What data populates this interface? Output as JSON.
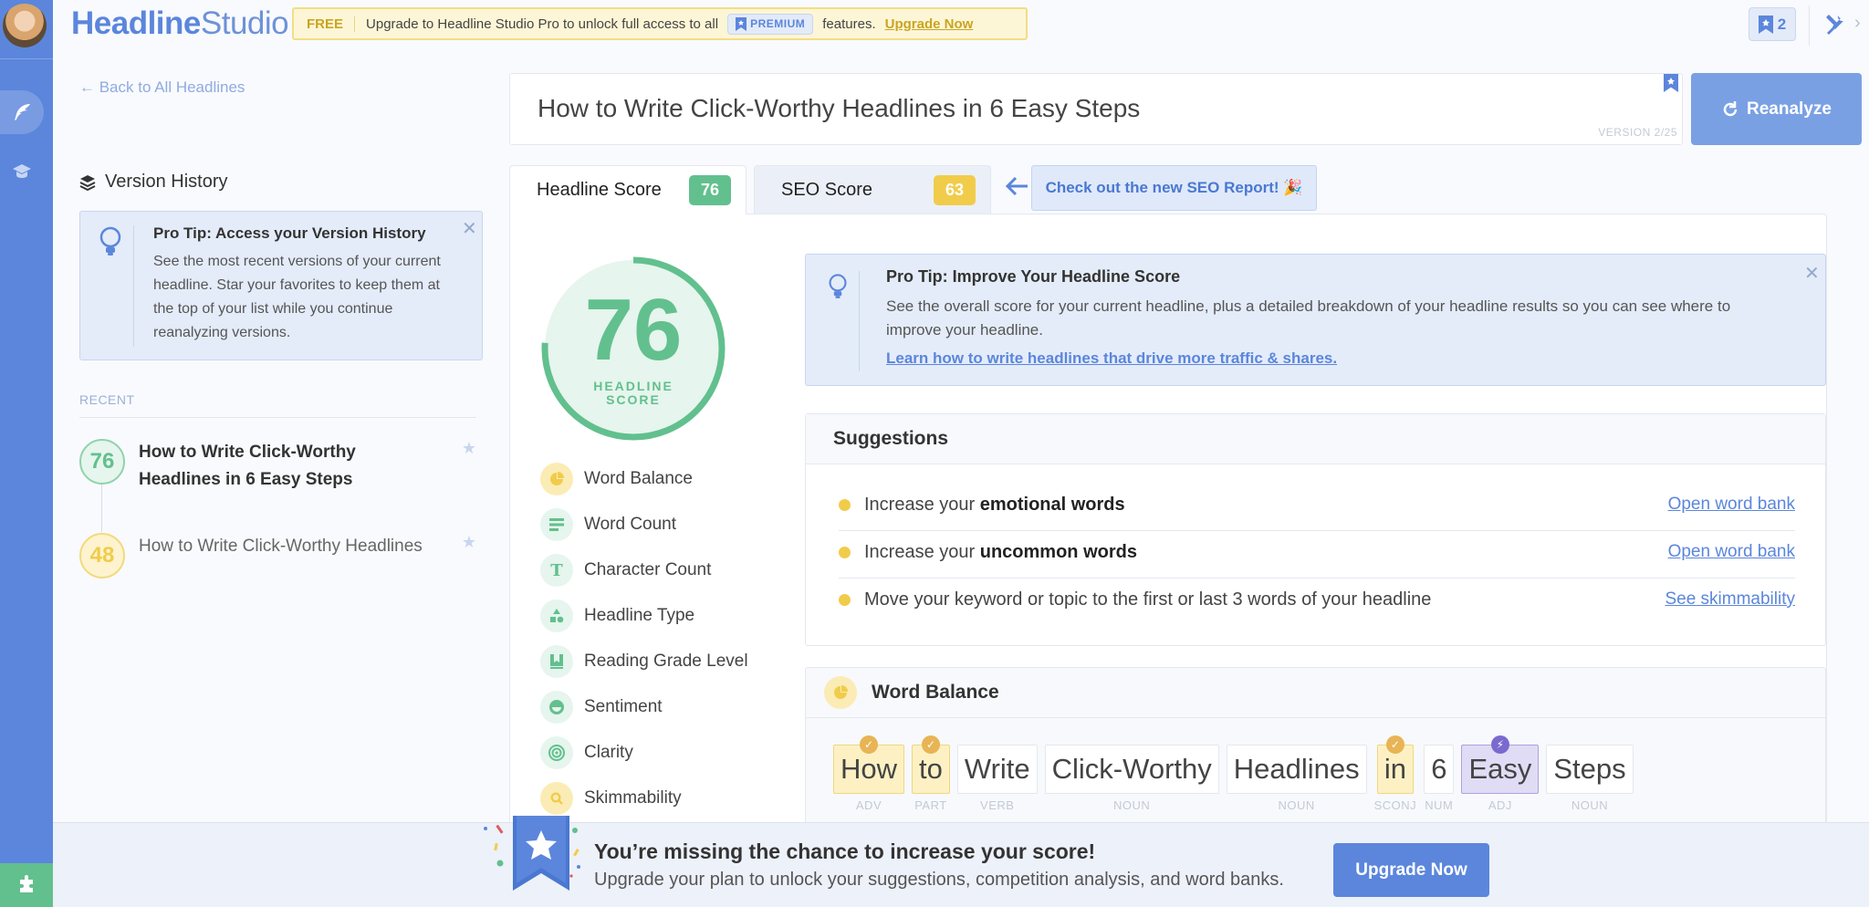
{
  "header": {
    "logo_bold": "Headline",
    "logo_light": "Studio",
    "promo": {
      "plan": "FREE",
      "text_before": "Upgrade to Headline Studio Pro to unlock full access to all",
      "premium_label": "PREMIUM",
      "text_after": "features.",
      "upgrade_link": "Upgrade Now"
    },
    "saved_count": "2"
  },
  "left_panel": {
    "back_link": "← Back to All Headlines",
    "version_history_title": "Version History",
    "pro_tip": {
      "title": "Pro Tip: Access your Version History",
      "body": "See the most recent versions of your current headline. Star your favorites to keep them at the top of your list while you continue reanalyzing versions."
    },
    "recent_label": "RECENT",
    "versions": [
      {
        "score": "76",
        "text": "How to Write Click-Worthy Headlines in 6 Easy Steps",
        "current": true,
        "color": "#62c08e"
      },
      {
        "score": "48",
        "text": "How to Write Click-Worthy Headlines",
        "current": false,
        "color": "#f1cc4a"
      }
    ]
  },
  "headline": {
    "text": "How to Write Click-Worthy Headlines in 6 Easy Steps",
    "version": "VERSION 2/25",
    "reanalyze_label": "Reanalyze"
  },
  "tabs": [
    {
      "label": "Headline Score",
      "score": "76",
      "color": "#62c08e",
      "active": true
    },
    {
      "label": "SEO Score",
      "score": "63",
      "color": "#f1cc4a",
      "active": false
    }
  ],
  "seo_callout": "Check out the new SEO Report! 🎉",
  "score_gauge": {
    "value": "76",
    "fraction": 0.76,
    "label_line1": "HEADLINE",
    "label_line2": "SCORE",
    "color": "#62c08e"
  },
  "metrics": [
    {
      "label": "Word Balance",
      "icon": "pie-chart-icon",
      "status": "warning"
    },
    {
      "label": "Word Count",
      "icon": "lines-icon",
      "status": "good"
    },
    {
      "label": "Character Count",
      "icon": "text-t-icon",
      "status": "good"
    },
    {
      "label": "Headline Type",
      "icon": "shapes-icon",
      "status": "good"
    },
    {
      "label": "Reading Grade Level",
      "icon": "book-icon",
      "status": "good"
    },
    {
      "label": "Sentiment",
      "icon": "smile-icon",
      "status": "good"
    },
    {
      "label": "Clarity",
      "icon": "target-icon",
      "status": "good"
    },
    {
      "label": "Skimmability",
      "icon": "search-icon",
      "status": "warning"
    }
  ],
  "pro_tip_main": {
    "title": "Pro Tip: Improve Your Headline Score",
    "body": "See the overall score for your current headline, plus a detailed breakdown of your headline results so you can see where to improve your headline.",
    "link": "Learn how to write headlines that drive more traffic & shares."
  },
  "suggestions": {
    "title": "Suggestions",
    "items": [
      {
        "prefix": "Increase your ",
        "bold": "emotional words",
        "suffix": "",
        "link": "Open word bank"
      },
      {
        "prefix": "Increase your ",
        "bold": "uncommon words",
        "suffix": "",
        "link": "Open word bank"
      },
      {
        "prefix": "Move your keyword or topic to the first or last 3 words of your headline",
        "bold": "",
        "suffix": "",
        "link": "See skimmability"
      }
    ]
  },
  "word_balance": {
    "title": "Word Balance",
    "words": [
      {
        "word": "How",
        "pos": "ADV",
        "type": "common"
      },
      {
        "word": "to",
        "pos": "PART",
        "type": "common"
      },
      {
        "word": "Write",
        "pos": "VERB",
        "type": "none"
      },
      {
        "word": "Click-Worthy",
        "pos": "NOUN",
        "type": "none"
      },
      {
        "word": "Headlines",
        "pos": "NOUN",
        "type": "none"
      },
      {
        "word": "in",
        "pos": "SCONJ",
        "type": "common"
      },
      {
        "word": "6",
        "pos": "NUM",
        "type": "none"
      },
      {
        "word": "Easy",
        "pos": "ADJ",
        "type": "power"
      },
      {
        "word": "Steps",
        "pos": "NOUN",
        "type": "none"
      }
    ]
  },
  "footer": {
    "title": "You’re missing the chance to increase your score!",
    "subtitle": "Upgrade your plan to unlock your suggestions, competition analysis, and word banks.",
    "button": "Upgrade Now"
  },
  "colors": {
    "brand_blue": "#5b86dc",
    "good_green": "#62c08e",
    "warn_yellow": "#f1cc4a",
    "power_purple": "#7a6ad0"
  }
}
